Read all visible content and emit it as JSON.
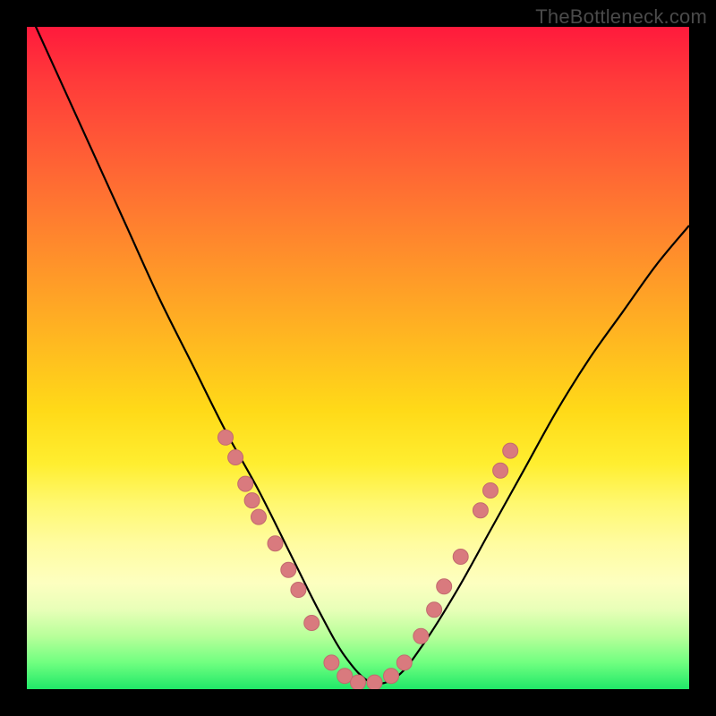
{
  "watermark": "TheBottleneck.com",
  "colors": {
    "background": "#000000",
    "gradient_top": "#ff1a3c",
    "gradient_mid": "#ffee30",
    "gradient_bottom": "#20e868",
    "curve": "#000000",
    "marker_fill": "#d97a7e",
    "marker_stroke": "#c26a6e"
  },
  "chart_data": {
    "type": "line",
    "title": "",
    "xlabel": "",
    "ylabel": "",
    "xlim": [
      0,
      100
    ],
    "ylim": [
      0,
      100
    ],
    "grid": false,
    "legend": null,
    "series": [
      {
        "name": "curve",
        "x": [
          0,
          5,
          10,
          15,
          20,
          25,
          30,
          35,
          40,
          44,
          48,
          52,
          56,
          60,
          65,
          70,
          75,
          80,
          85,
          90,
          95,
          100
        ],
        "y": [
          103,
          92,
          81,
          70,
          59,
          49,
          39,
          30,
          20,
          12,
          5,
          1,
          2,
          7,
          15,
          24,
          33,
          42,
          50,
          57,
          64,
          70
        ]
      }
    ],
    "markers": [
      {
        "x": 30.0,
        "y": 38.0
      },
      {
        "x": 31.5,
        "y": 35.0
      },
      {
        "x": 33.0,
        "y": 31.0
      },
      {
        "x": 34.0,
        "y": 28.5
      },
      {
        "x": 35.0,
        "y": 26.0
      },
      {
        "x": 37.5,
        "y": 22.0
      },
      {
        "x": 39.5,
        "y": 18.0
      },
      {
        "x": 41.0,
        "y": 15.0
      },
      {
        "x": 43.0,
        "y": 10.0
      },
      {
        "x": 46.0,
        "y": 4.0
      },
      {
        "x": 48.0,
        "y": 2.0
      },
      {
        "x": 50.0,
        "y": 1.0
      },
      {
        "x": 52.5,
        "y": 1.0
      },
      {
        "x": 55.0,
        "y": 2.0
      },
      {
        "x": 57.0,
        "y": 4.0
      },
      {
        "x": 59.5,
        "y": 8.0
      },
      {
        "x": 61.5,
        "y": 12.0
      },
      {
        "x": 63.0,
        "y": 15.5
      },
      {
        "x": 65.5,
        "y": 20.0
      },
      {
        "x": 68.5,
        "y": 27.0
      },
      {
        "x": 70.0,
        "y": 30.0
      },
      {
        "x": 71.5,
        "y": 33.0
      },
      {
        "x": 73.0,
        "y": 36.0
      }
    ]
  }
}
